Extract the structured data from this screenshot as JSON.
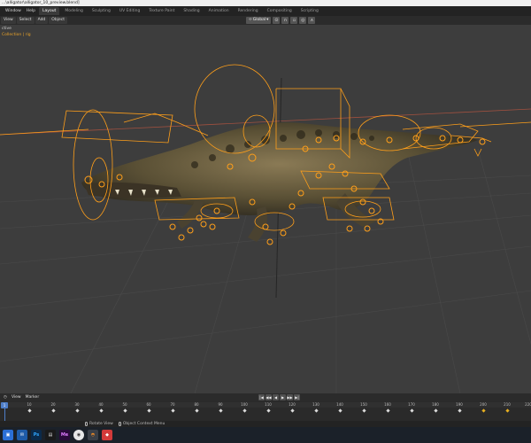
{
  "window": {
    "title": "...\\alligator\\alligator_10_preview.blend]"
  },
  "topbar": {
    "menus": [
      "Window",
      "Help"
    ],
    "workspace_tabs": [
      "Layout",
      "Modeling",
      "Sculpting",
      "UV Editing",
      "Texture Paint",
      "Shading",
      "Animation",
      "Rendering",
      "Compositing",
      "Scripting"
    ],
    "active_tab": "Layout"
  },
  "header": {
    "menus": [
      "View",
      "Select",
      "Add",
      "Object"
    ],
    "transform_orientation": "Global"
  },
  "viewport": {
    "overlay_line1": "ctive",
    "overlay_line2": "Collection | rig",
    "overlay_color": "#e8a22a"
  },
  "timeline": {
    "menus": [
      "View",
      "Marker"
    ],
    "current_frame": "1",
    "frame_labels": [
      "10",
      "20",
      "30",
      "40",
      "50",
      "60",
      "70",
      "80",
      "90",
      "100",
      "110",
      "120",
      "130",
      "140",
      "150",
      "160",
      "170",
      "180",
      "190",
      "200",
      "210",
      "220"
    ]
  },
  "statusbar": {
    "rotate_view": "Rotate View",
    "context_menu": "Object Context Menu"
  },
  "colors": {
    "rig_orange": "#ff9f1a",
    "active_tab_bg": "#3a3a3a",
    "taskbar_bg": "#1b2129"
  }
}
